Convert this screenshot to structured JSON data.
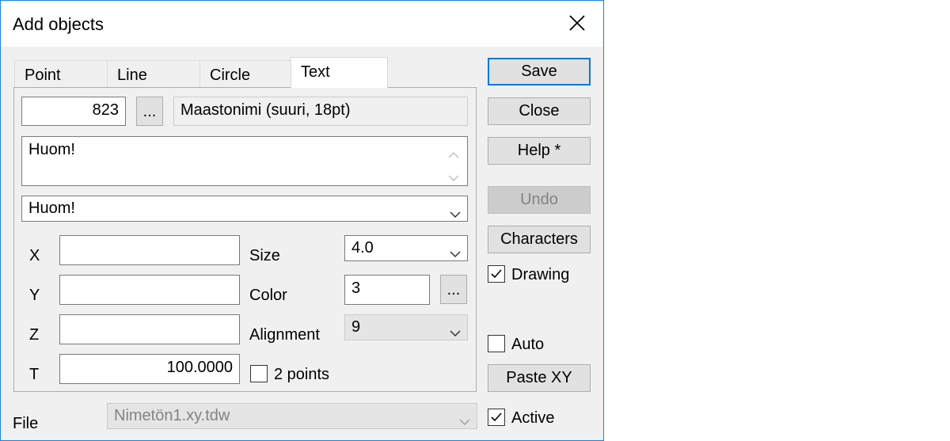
{
  "window": {
    "title": "Add objects"
  },
  "tabs": [
    {
      "label": "Point"
    },
    {
      "label": "Line"
    },
    {
      "label": "Circle"
    },
    {
      "label": "Text"
    }
  ],
  "text_tab": {
    "code_value": "823",
    "browse_label": "...",
    "style_name": "Maastonimi (suuri, 18pt)",
    "multiline_text": "Huom!",
    "text_combo_value": "Huom!",
    "coords": {
      "x_label": "X",
      "x_value": "",
      "y_label": "Y",
      "y_value": "",
      "z_label": "Z",
      "z_value": "",
      "t_label": "T",
      "t_value": "100.0000"
    },
    "size_label": "Size",
    "size_value": "4.0",
    "color_label": "Color",
    "color_value": "3",
    "color_browse_label": "...",
    "alignment_label": "Alignment",
    "alignment_value": "9",
    "two_points_label": "2 points",
    "two_points_checked": false
  },
  "file": {
    "label": "File",
    "value": "Nimetön1.xy.tdw"
  },
  "buttons": {
    "save": "Save",
    "close": "Close",
    "help": "Help *",
    "undo": "Undo",
    "characters": "Characters",
    "paste_xy": "Paste XY"
  },
  "checkboxes": {
    "drawing": {
      "label": "Drawing",
      "checked": true
    },
    "auto": {
      "label": "Auto",
      "checked": false
    },
    "active": {
      "label": "Active",
      "checked": true
    }
  },
  "colors": {
    "accent": "#0078d7",
    "window_border": "#1883d7",
    "face": "#f0f0f0"
  }
}
